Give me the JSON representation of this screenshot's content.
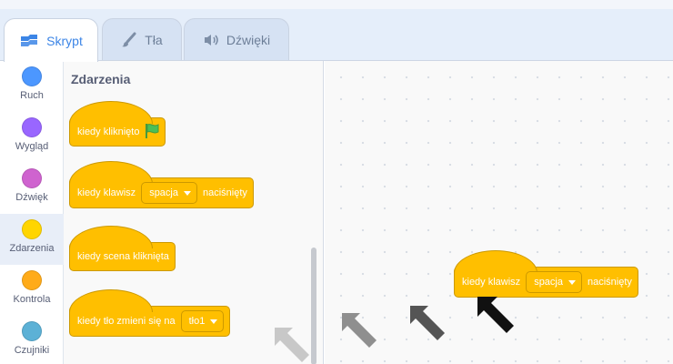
{
  "tabs": [
    {
      "label": "Skrypt",
      "icon": "code-icon",
      "active": true
    },
    {
      "label": "Tła",
      "icon": "brush-icon",
      "active": false
    },
    {
      "label": "Dźwięki",
      "icon": "speaker-icon",
      "active": false
    }
  ],
  "categories": [
    {
      "label": "Ruch",
      "color": "#4c97ff"
    },
    {
      "label": "Wygląd",
      "color": "#9966ff"
    },
    {
      "label": "Dźwięk",
      "color": "#cf63cf"
    },
    {
      "label": "Zdarzenia",
      "color": "#ffd500",
      "selected": true
    },
    {
      "label": "Kontrola",
      "color": "#ffab19"
    },
    {
      "label": "Czujniki",
      "color": "#5cb1d6"
    }
  ],
  "palette": {
    "title": "Zdarzenia",
    "blocks": [
      {
        "text": "kiedy kliknięto",
        "icon": "green-flag-icon"
      },
      {
        "text_before": "kiedy klawisz",
        "dropdown": "spacja",
        "text_after": "naciśnięty"
      },
      {
        "text": "kiedy scena kliknięta"
      },
      {
        "text_before": "kiedy tło zmieni się na",
        "dropdown": "tło1"
      }
    ]
  },
  "script_area": {
    "block": {
      "text_before": "kiedy klawisz",
      "dropdown": "spacja",
      "text_after": "naciśnięty"
    }
  },
  "colors": {
    "events_block": "#ffbf00",
    "events_border": "#cc9900",
    "accent": "#3c85e6",
    "arrow_shades": [
      "#c8c8c8",
      "#8f8f8f",
      "#555555",
      "#111111"
    ]
  }
}
